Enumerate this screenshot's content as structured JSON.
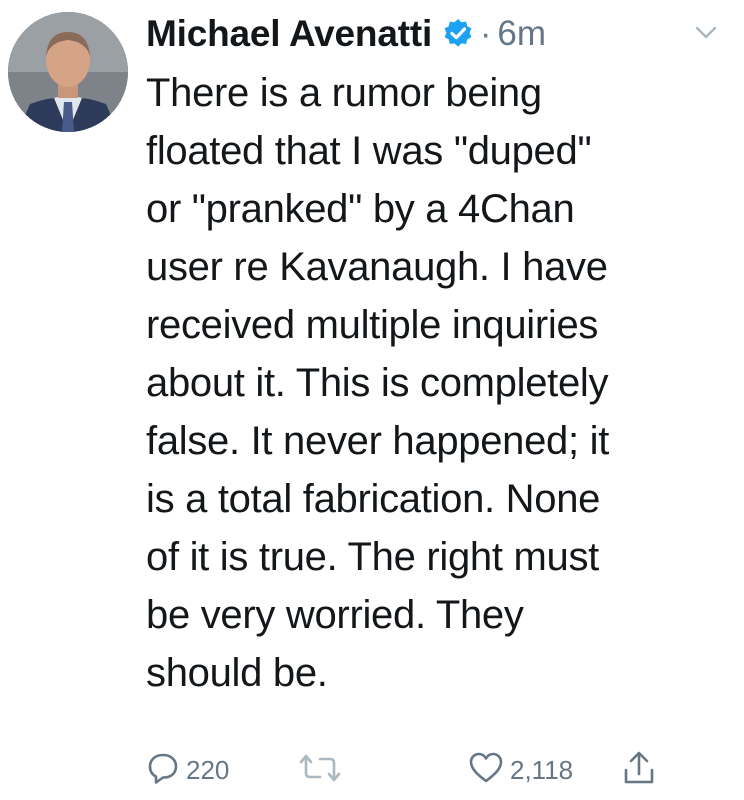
{
  "tweet": {
    "author": "Michael Avenatti",
    "separator": "·",
    "time": "6m",
    "text_lines": [
      "There is a rumor being",
      "floated that I was \"duped\"",
      "or \"pranked\" by a 4Chan",
      "user re Kavanaugh. I have",
      "received multiple inquiries",
      "about it. This is completely",
      "false. It never happened; it",
      "is a total fabrication. None",
      "of it is true. The right must",
      "be very worried. They",
      "should be."
    ],
    "replies": "220",
    "retweets": "",
    "likes": "2,118"
  },
  "colors": {
    "text": "#14171a",
    "muted": "#657786",
    "verified": "#1da1f2"
  },
  "icons": {
    "verified": "verified-badge-icon",
    "caret": "chevron-down-icon",
    "reply": "reply-icon",
    "retweet": "retweet-icon",
    "like": "heart-icon",
    "share": "share-icon"
  }
}
